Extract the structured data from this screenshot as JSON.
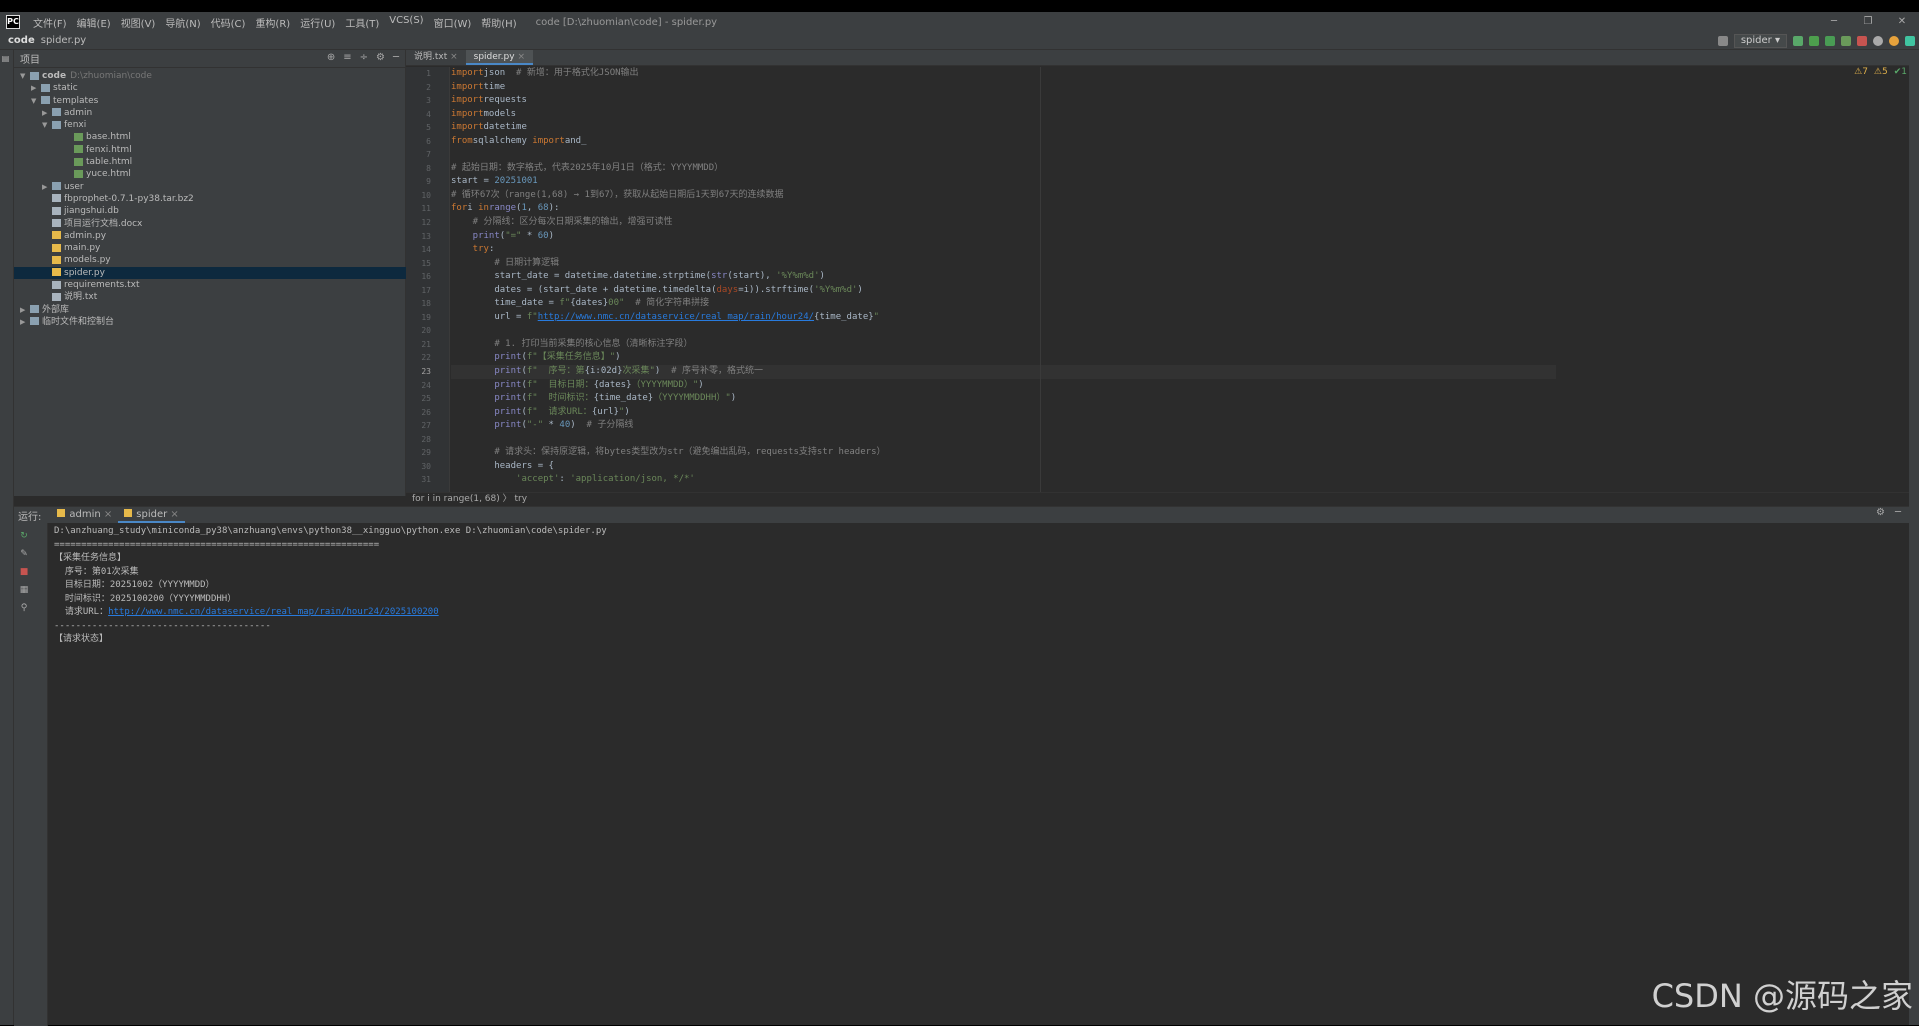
{
  "titlebar": {
    "logo": "PC",
    "menu": [
      "文件(F)",
      "编辑(E)",
      "视图(V)",
      "导航(N)",
      "代码(C)",
      "重构(R)",
      "运行(U)",
      "工具(T)",
      "VCS(S)",
      "窗口(W)",
      "帮助(H)"
    ],
    "window_title": "code [D:\\zhuomian\\code] - spider.py",
    "min": "─",
    "max": "❐",
    "close": "✕"
  },
  "navbar": {
    "project": "code",
    "file": "spider.py",
    "run_config": "spider ▾"
  },
  "project_panel": {
    "title": "项目",
    "tree": [
      {
        "name": "code",
        "extra": "D:\\zhuomian\\code",
        "depth": 0,
        "arrow": "▼",
        "type": "folder",
        "bold": true
      },
      {
        "name": "static",
        "depth": 1,
        "arrow": "▶",
        "type": "folder"
      },
      {
        "name": "templates",
        "depth": 1,
        "arrow": "▼",
        "type": "folder"
      },
      {
        "name": "admin",
        "depth": 2,
        "arrow": "▶",
        "type": "folder"
      },
      {
        "name": "fenxi",
        "depth": 2,
        "arrow": "▼",
        "type": "folder"
      },
      {
        "name": "base.html",
        "depth": 4,
        "arrow": "",
        "type": "html"
      },
      {
        "name": "fenxi.html",
        "depth": 4,
        "arrow": "",
        "type": "html"
      },
      {
        "name": "table.html",
        "depth": 4,
        "arrow": "",
        "type": "html"
      },
      {
        "name": "yuce.html",
        "depth": 4,
        "arrow": "",
        "type": "html"
      },
      {
        "name": "user",
        "depth": 2,
        "arrow": "▶",
        "type": "folder"
      },
      {
        "name": "fbprophet-0.7.1-py38.tar.bz2",
        "depth": 2,
        "arrow": "",
        "type": "file"
      },
      {
        "name": "jiangshui.db",
        "depth": 2,
        "arrow": "",
        "type": "file"
      },
      {
        "name": "项目运行文档.docx",
        "depth": 2,
        "arrow": "",
        "type": "file"
      },
      {
        "name": "admin.py",
        "depth": 2,
        "arrow": "",
        "type": "py"
      },
      {
        "name": "main.py",
        "depth": 2,
        "arrow": "",
        "type": "py"
      },
      {
        "name": "models.py",
        "depth": 2,
        "arrow": "",
        "type": "py"
      },
      {
        "name": "spider.py",
        "depth": 2,
        "arrow": "",
        "type": "py",
        "selected": true
      },
      {
        "name": "requirements.txt",
        "depth": 2,
        "arrow": "",
        "type": "file"
      },
      {
        "name": "说明.txt",
        "depth": 2,
        "arrow": "",
        "type": "file"
      },
      {
        "name": "外部库",
        "depth": 0,
        "arrow": "▶",
        "type": "folder"
      },
      {
        "name": "临时文件和控制台",
        "depth": 0,
        "arrow": "▶",
        "type": "folder"
      }
    ]
  },
  "editor": {
    "tabs": [
      {
        "label": "说明.txt",
        "active": false
      },
      {
        "label": "spider.py",
        "active": true
      }
    ],
    "inspections": {
      "warn1": "⚠7",
      "warn2": "⚠5",
      "ok": "✔1"
    },
    "current_line": 23,
    "lines": [
      [
        [
          "kw",
          "import"
        ],
        [
          "",
          "json"
        ],
        [
          "cm",
          "  # 新增：用于格式化JSON输出"
        ]
      ],
      [
        [
          "kw",
          "import"
        ],
        [
          "",
          "time"
        ]
      ],
      [
        [
          "kw",
          "import"
        ],
        [
          "",
          "requests"
        ]
      ],
      [
        [
          "kw",
          "import"
        ],
        [
          "",
          "models"
        ]
      ],
      [
        [
          "kw",
          "import"
        ],
        [
          "",
          "datetime"
        ]
      ],
      [
        [
          "kw",
          "from"
        ],
        [
          "",
          "sqlalchemy "
        ],
        [
          "kw",
          "import"
        ],
        [
          "",
          "and_"
        ]
      ],
      [],
      [
        [
          "cm",
          "# 起始日期：数字格式，代表2025年10月1日（格式：YYYYMMDD）"
        ]
      ],
      [
        [
          "",
          "start = "
        ],
        [
          "nm",
          "20251001"
        ]
      ],
      [
        [
          "cm",
          "# 循环67次（range(1,68) → 1到67），获取从起始日期后1天到67天的连续数据"
        ]
      ],
      [
        [
          "kw",
          "for"
        ],
        [
          "",
          "i "
        ],
        [
          "kw",
          "in"
        ],
        [
          "fn",
          "range"
        ],
        [
          "",
          "("
        ],
        [
          "nm",
          "1"
        ],
        [
          "",
          ", "
        ],
        [
          "nm",
          "68"
        ],
        [
          "",
          "):"
        ]
      ],
      [
        [
          "cm",
          "    # 分隔线：区分每次日期采集的输出，增强可读性"
        ]
      ],
      [
        [
          "fn",
          "    print"
        ],
        [
          "",
          "("
        ],
        [
          "st",
          "\"=\""
        ],
        [
          "",
          " * "
        ],
        [
          "nm",
          "60"
        ],
        [
          "",
          ")"
        ]
      ],
      [
        [
          "kw",
          "    try"
        ],
        [
          "",
          ":"
        ]
      ],
      [
        [
          "cm",
          "        # 日期计算逻辑"
        ]
      ],
      [
        [
          "",
          "        start_date = datetime.datetime.strptime("
        ],
        [
          "fn",
          "str"
        ],
        [
          "",
          "(start), "
        ],
        [
          "st",
          "'%Y%m%d'"
        ],
        [
          "",
          ")"
        ]
      ],
      [
        [
          "",
          "        dates = (start_date + datetime.timedelta("
        ],
        [
          "pm",
          "days"
        ],
        [
          "",
          "=i)).strftime("
        ],
        [
          "st",
          "'%Y%m%d'"
        ],
        [
          "",
          ")"
        ]
      ],
      [
        [
          "",
          "        time_date = "
        ],
        [
          "st",
          "f\""
        ],
        [
          "",
          "{dates}"
        ],
        [
          "st",
          "00\""
        ],
        [
          "cm",
          "  # 简化字符串拼接"
        ]
      ],
      [
        [
          "",
          "        url = "
        ],
        [
          "st",
          "f\""
        ],
        [
          "url",
          "http://www.nmc.cn/dataservice/real_map/rain/hour24/"
        ],
        [
          "",
          "{time_date}"
        ],
        [
          "st",
          "\""
        ]
      ],
      [],
      [
        [
          "cm",
          "        # 1. 打印当前采集的核心信息（清晰标注字段）"
        ]
      ],
      [
        [
          "fn",
          "        print"
        ],
        [
          "",
          "("
        ],
        [
          "st",
          "f\"【采集任务信息】\""
        ],
        [
          "",
          ")"
        ]
      ],
      [
        [
          "fn",
          "        print"
        ],
        [
          "",
          "("
        ],
        [
          "st",
          "f\"  序号：第"
        ],
        [
          "",
          "{i:02d}"
        ],
        [
          "st",
          "次采集\""
        ],
        [
          "",
          ")"
        ],
        [
          "cm",
          "  # 序号补零，格式统一"
        ]
      ],
      [
        [
          "fn",
          "        print"
        ],
        [
          "",
          "("
        ],
        [
          "st",
          "f\"  目标日期："
        ],
        [
          "",
          "{dates}"
        ],
        [
          "st",
          "（YYYYMMDD）\""
        ],
        [
          "",
          ")"
        ]
      ],
      [
        [
          "fn",
          "        print"
        ],
        [
          "",
          "("
        ],
        [
          "st",
          "f\"  时间标识："
        ],
        [
          "",
          "{time_date}"
        ],
        [
          "st",
          "（YYYYMMDDHH）\""
        ],
        [
          "",
          ")"
        ]
      ],
      [
        [
          "fn",
          "        print"
        ],
        [
          "",
          "("
        ],
        [
          "st",
          "f\"  请求URL："
        ],
        [
          "",
          "{url}"
        ],
        [
          "st",
          "\""
        ],
        [
          "",
          ")"
        ]
      ],
      [
        [
          "fn",
          "        print"
        ],
        [
          "",
          "("
        ],
        [
          "st",
          "\"-\""
        ],
        [
          "",
          " * "
        ],
        [
          "nm",
          "40"
        ],
        [
          "",
          ")"
        ],
        [
          "cm",
          "  # 子分隔线"
        ]
      ],
      [],
      [
        [
          "cm",
          "        # 请求头：保持原逻辑，将bytes类型改为str（避免编出乱码，requests支持str headers）"
        ]
      ],
      [
        [
          "",
          "        headers = {"
        ]
      ],
      [
        [
          "st",
          "            'accept'"
        ],
        [
          "",
          ": "
        ],
        [
          "st",
          "'application/json, */*'"
        ]
      ]
    ],
    "breadcrumb": [
      "for i in range(1, 68)",
      "try"
    ]
  },
  "run_panel": {
    "label": "运行:",
    "tabs": [
      {
        "label": "admin",
        "active": false
      },
      {
        "label": "spider",
        "active": true
      }
    ],
    "console": [
      [
        [
          "",
          "D:\\anzhuang_study\\miniconda_py38\\anzhuang\\envs\\python38__xingguo\\python.exe D:\\zhuomian\\code\\spider.py"
        ]
      ],
      [
        [
          "",
          "============================================================"
        ]
      ],
      [
        [
          "",
          "【采集任务信息】"
        ]
      ],
      [
        [
          "",
          "  序号：第01次采集"
        ]
      ],
      [
        [
          "",
          "  目标日期：20251002（YYYYMMDD）"
        ]
      ],
      [
        [
          "",
          "  时间标识：2025100200（YYYYMMDDHH）"
        ]
      ],
      [
        [
          "",
          "  请求URL："
        ],
        [
          "url",
          "http://www.nmc.cn/dataservice/real_map/rain/hour24/2025100200"
        ]
      ],
      [
        [
          "",
          "----------------------------------------"
        ]
      ],
      [
        [
          "",
          "【请求状态】"
        ]
      ]
    ]
  },
  "watermark": "CSDN @源码之家"
}
